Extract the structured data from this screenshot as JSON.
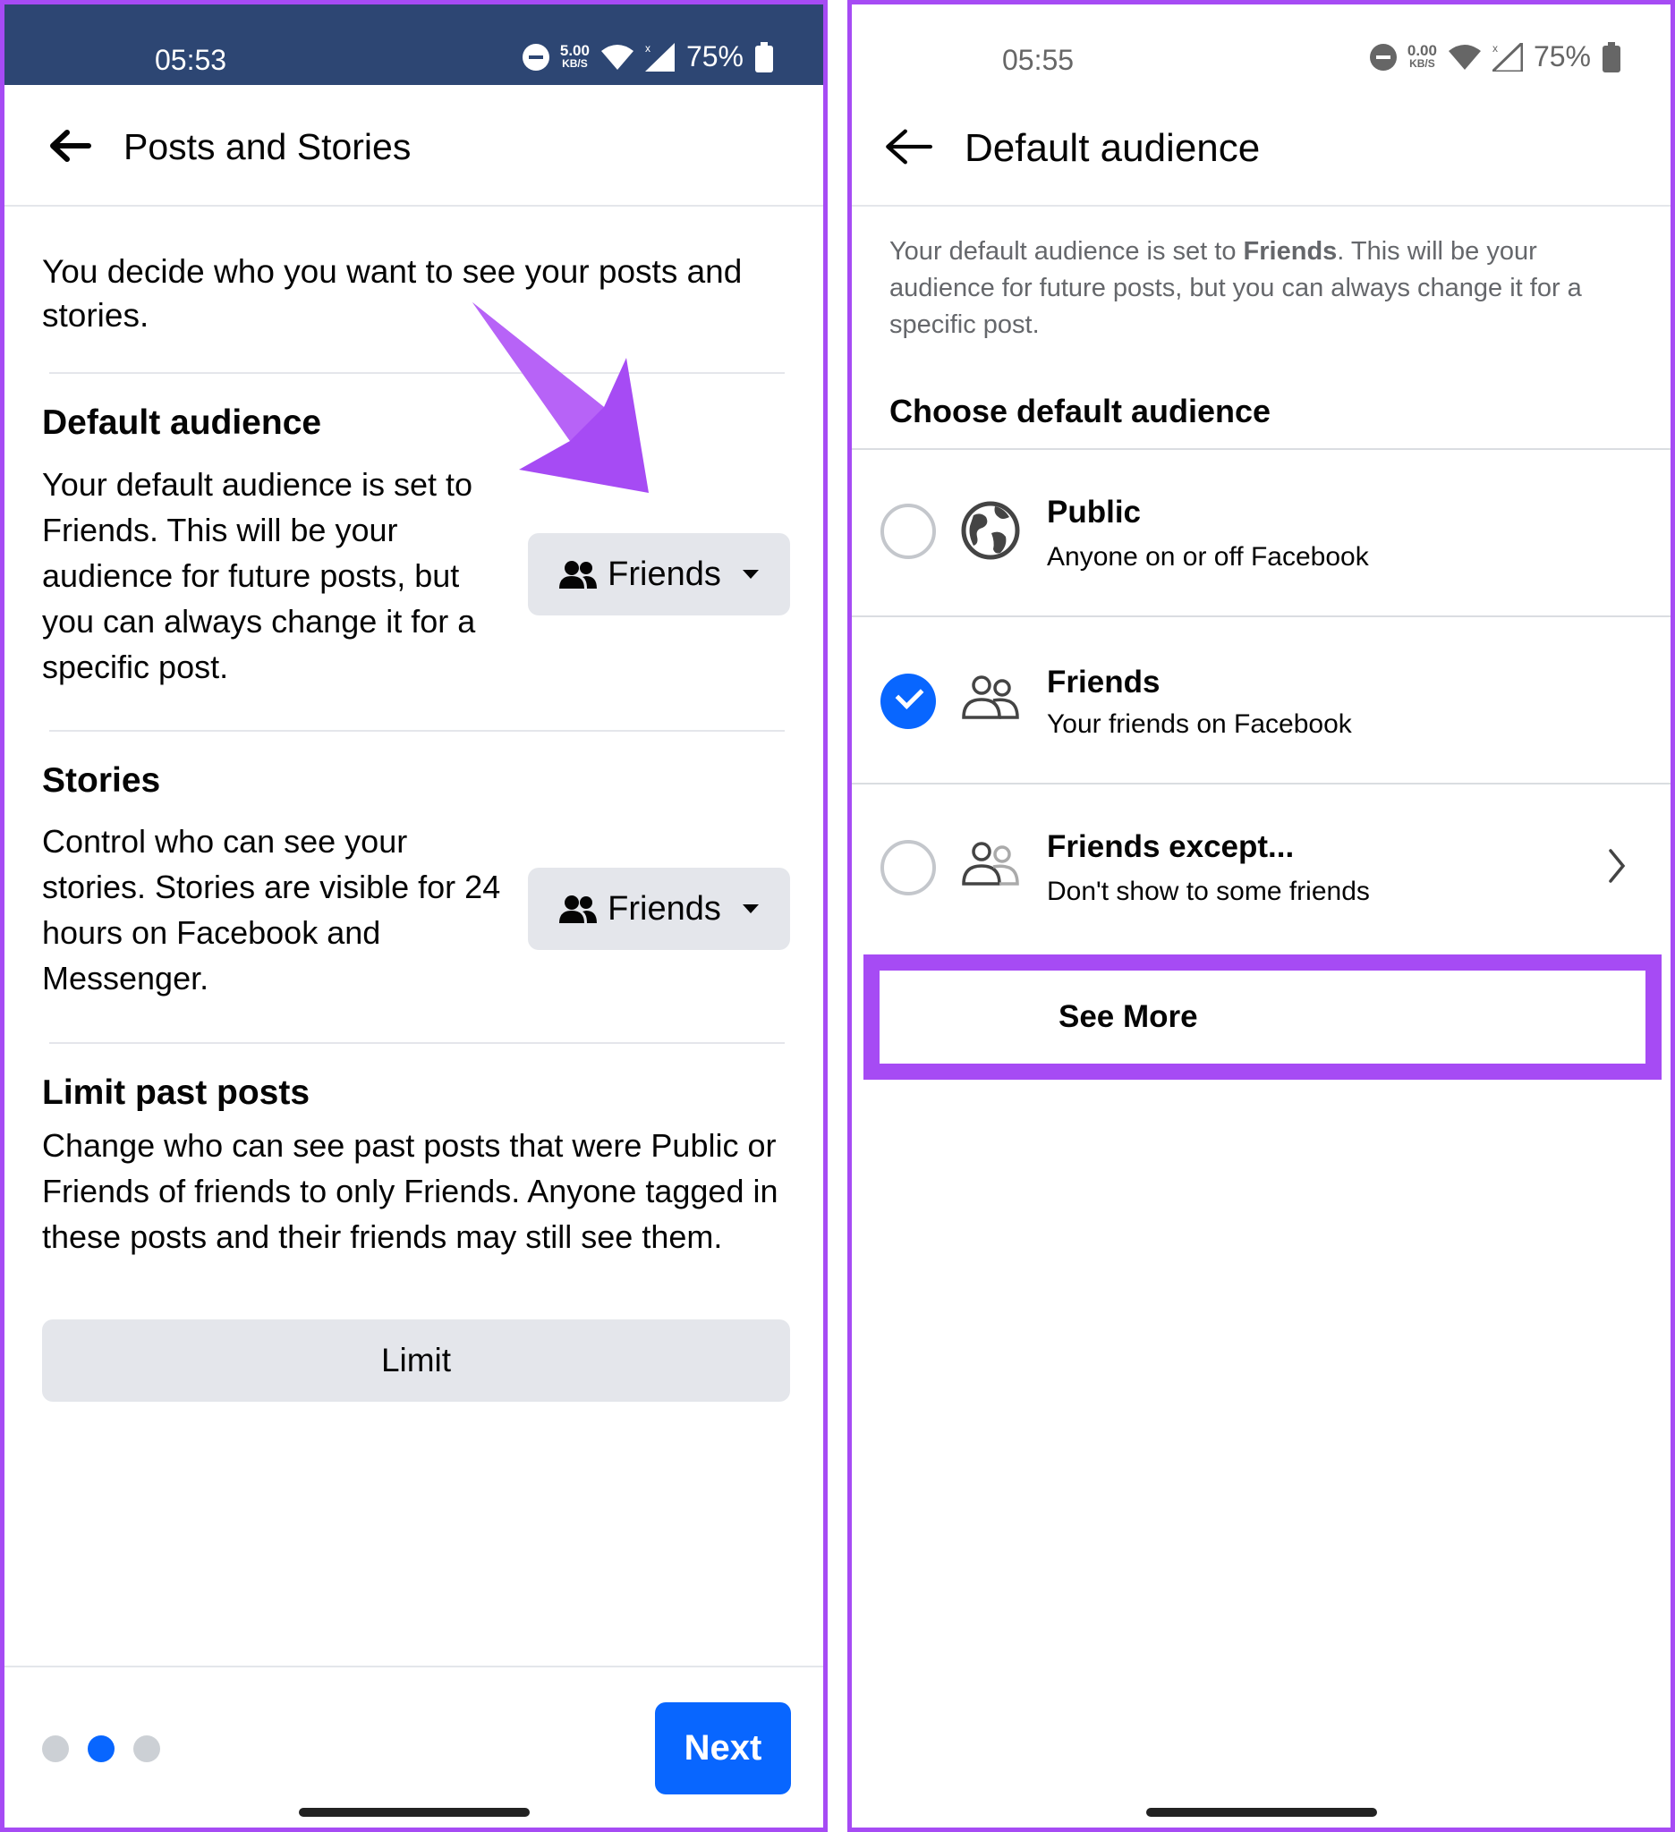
{
  "left": {
    "status": {
      "time": "05:53",
      "speed": "5.00",
      "speed_unit": "KB/S",
      "battery": "75%"
    },
    "header": {
      "title": "Posts and Stories"
    },
    "intro": "You decide who you want to see your posts and stories.",
    "default_audience": {
      "title": "Default audience",
      "body": "Your default audience is set to Friends. This will be your audience for future posts, but you can always change it for a specific post.",
      "button": "Friends"
    },
    "stories": {
      "title": "Stories",
      "body": "Control who can see your stories. Stories are visible for 24 hours on Facebook and Messenger.",
      "button": "Friends"
    },
    "limit_past": {
      "title": "Limit past posts",
      "body": "Change who can see past posts that were Public or Friends of friends to only Friends. Anyone tagged in these posts and their friends may still see them.",
      "button": "Limit"
    },
    "footer": {
      "next": "Next",
      "page_total": 3,
      "page_current": 2
    }
  },
  "right": {
    "status": {
      "time": "05:55",
      "speed": "0.00",
      "speed_unit": "KB/S",
      "battery": "75%"
    },
    "header": {
      "title": "Default audience"
    },
    "desc_pre": "Your default audience is set to ",
    "desc_bold": "Friends",
    "desc_post": ". This will be your audience for future posts, but you can always change it for a specific post.",
    "choose_label": "Choose default audience",
    "options": [
      {
        "title": "Public",
        "subtitle": "Anyone on or off Facebook",
        "icon": "globe-icon",
        "selected": false
      },
      {
        "title": "Friends",
        "subtitle": "Your friends on Facebook",
        "icon": "friends-icon",
        "selected": true
      },
      {
        "title": "Friends except...",
        "subtitle": "Don't show to some friends",
        "icon": "friends-except-icon",
        "selected": false
      }
    ],
    "see_more": "See More"
  },
  "colors": {
    "accent": "#0866ff",
    "highlight": "#a64bf4",
    "statusbar": "#2d4673",
    "button_bg": "#e4e6eb"
  }
}
